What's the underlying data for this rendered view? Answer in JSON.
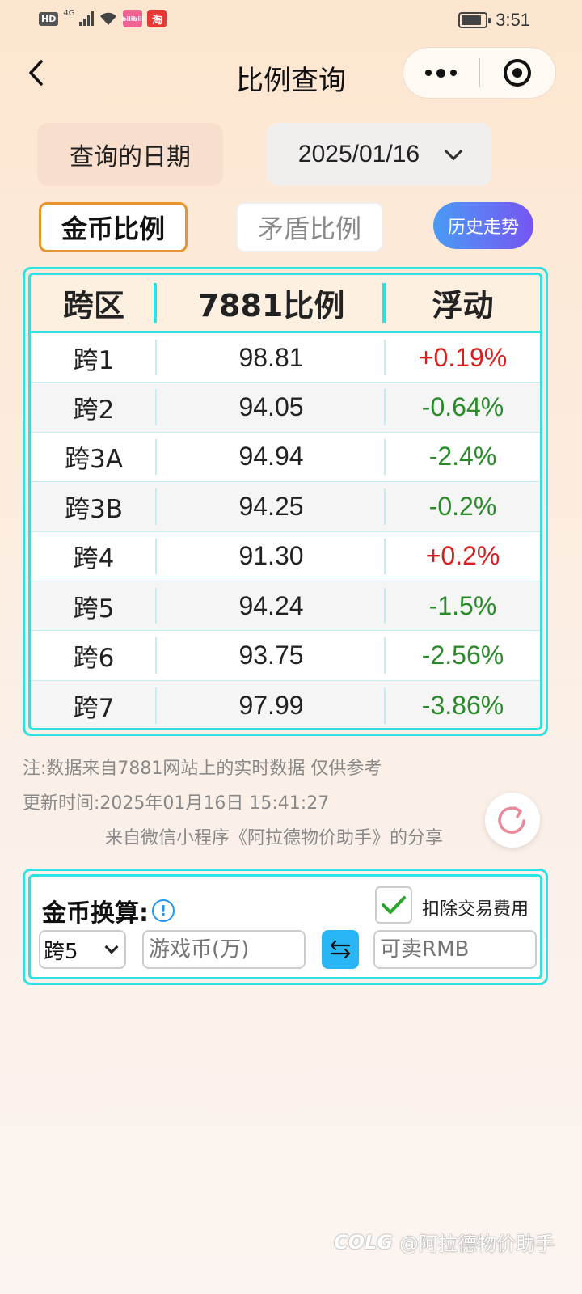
{
  "status_bar": {
    "hd": "HD",
    "network": "4G",
    "app_badge_1": "bilibili",
    "app_badge_2": "淘",
    "battery_level": 0.85,
    "time": "3:51"
  },
  "nav": {
    "title": "比例查询"
  },
  "query": {
    "date_label": "查询的日期",
    "date_value": "2025/01/16"
  },
  "tabs": {
    "gold": "金币比例",
    "shield": "矛盾比例",
    "history": "历史走势"
  },
  "table": {
    "headers": [
      "跨区",
      "7881比例",
      "浮动"
    ],
    "rows": [
      {
        "region": "跨1",
        "ratio": "98.81",
        "change": "+0.19%",
        "trend": "up"
      },
      {
        "region": "跨2",
        "ratio": "94.05",
        "change": "-0.64%",
        "trend": "down"
      },
      {
        "region": "跨3A",
        "ratio": "94.94",
        "change": "-2.4%",
        "trend": "down"
      },
      {
        "region": "跨3B",
        "ratio": "94.25",
        "change": "-0.2%",
        "trend": "down"
      },
      {
        "region": "跨4",
        "ratio": "91.30",
        "change": "+0.2%",
        "trend": "up"
      },
      {
        "region": "跨5",
        "ratio": "94.24",
        "change": "-1.5%",
        "trend": "down"
      },
      {
        "region": "跨6",
        "ratio": "93.75",
        "change": "-2.56%",
        "trend": "down"
      },
      {
        "region": "跨7",
        "ratio": "97.99",
        "change": "-3.86%",
        "trend": "down"
      }
    ]
  },
  "notes": {
    "source": "注:数据来自7881网站上的实时数据 仅供参考",
    "updated": "更新时间:2025年01月16日 15:41:27",
    "share": "来自微信小程序《阿拉德物价助手》的分享"
  },
  "converter": {
    "title": "金币换算:",
    "fee_label": "扣除交易费用",
    "fee_checked": true,
    "region_selected": "跨5",
    "coin_placeholder": "游戏币(万)",
    "rmb_placeholder": "可卖RMB"
  },
  "watermark": {
    "logo": "COLG",
    "text": "@阿拉德物价助手"
  },
  "colors": {
    "accent_cyan": "#2de2e2",
    "up_red": "#d81e1e",
    "down_green": "#2a8a2a",
    "tab_orange": "#e8952e"
  }
}
